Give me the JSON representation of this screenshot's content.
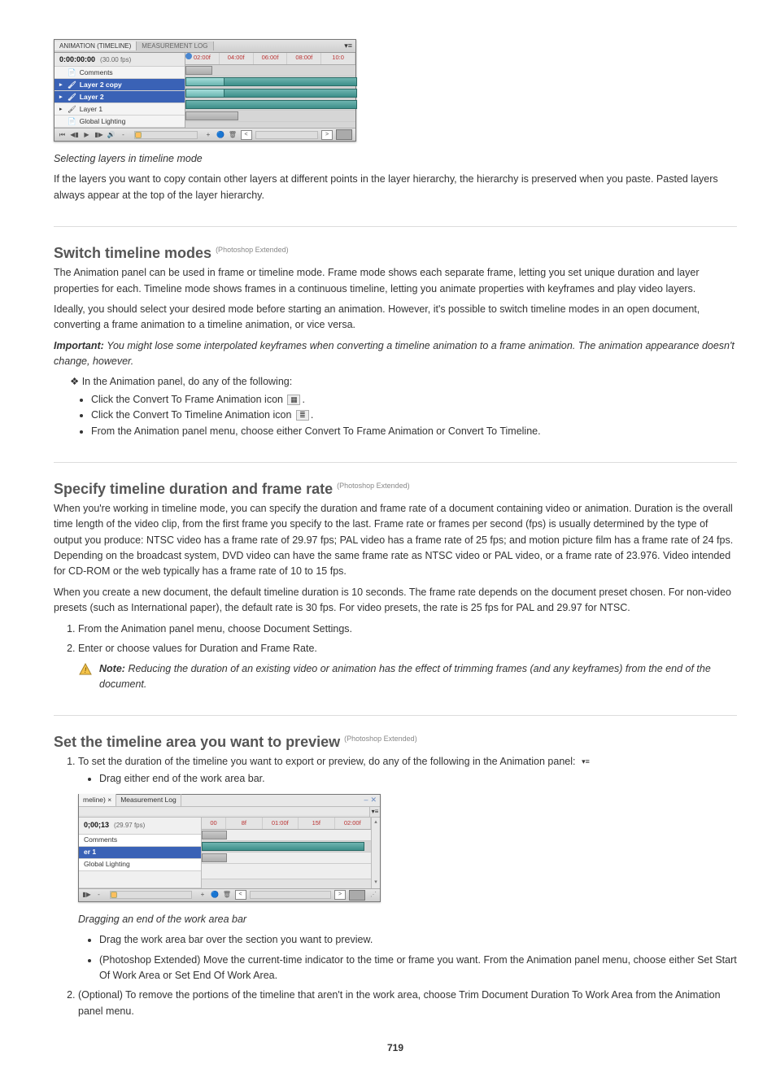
{
  "page_number": "719",
  "panel1": {
    "tab_active": "ANIMATION (TIMELINE)",
    "tab_inactive": "MEASUREMENT LOG",
    "timecode": "0:00:00:00",
    "fps": "(30.00 fps)",
    "rows": [
      "Comments",
      "Layer 2 copy",
      "Layer 2",
      "Layer 1",
      "Global Lighting"
    ],
    "ticks": [
      "02:00f",
      "04:00f",
      "06:00f",
      "08:00f",
      "10:0"
    ]
  },
  "caption1": "Selecting layers in timeline mode",
  "para_after_panel1": "If the layers you want to copy contain other layers at different points in the layer hierarchy, the hierarchy is preserved when you paste. Pasted layers always appear at the top of the layer hierarchy.",
  "heading_switch": "Switch timeline modes",
  "ref_switch": "(Photoshop Extended)",
  "switch_text": "The Animation panel can be used in frame or timeline mode. Frame mode shows each separate frame, letting you set unique duration and layer properties for each. Timeline mode shows frames in a continuous timeline, letting you animate properties with keyframes and play video layers.",
  "switch_text2": "Ideally, you should select your desired mode before starting an animation. However, it's possible to switch timeline modes in an open document, converting a frame animation to a timeline animation, or vice versa.",
  "switch_important_label": "Important:",
  "switch_important": "You might lose some interpolated keyframes when converting a timeline animation to a frame animation. The animation appearance doesn't change, however.",
  "switch_bullet_lead": "In the Animation panel, do any of the following:",
  "switch_bullets": [
    "Click the Convert To Frame Animation icon",
    "Click the Convert To Timeline Animation icon",
    "From the Animation panel menu, choose either Convert To Frame Animation or Convert To Timeline."
  ],
  "switch_inline_period": ".",
  "heading_dur": "Specify timeline duration and frame rate",
  "ref_dur": "(Photoshop Extended)",
  "dur_text": "When you're working in timeline mode, you can specify the duration and frame rate of a document containing video or animation. Duration is the overall time length of the video clip, from the first frame you specify to the last. Frame rate or frames per second (fps) is usually determined by the type of output you produce: NTSC video has a frame rate of 29.97 fps; PAL video has a frame rate of 25 fps; and motion picture film has a frame rate of 24 fps. Depending on the broadcast system, DVD video can have the same frame rate as NTSC video or PAL video, or a frame rate of 23.976. Video intended for CD-ROM or the web typically has a frame rate of 10 to 15 fps.",
  "dur_text2": "When you create a new document, the default timeline duration is 10 seconds. The frame rate depends on the document preset chosen. For non-video presets (such as International paper), the default rate is 30 fps. For video presets, the rate is 25 fps for PAL and 29.97 for NTSC.",
  "dur_steps": [
    "From the Animation panel menu, choose Document Settings.",
    "Enter or choose values for Duration and Frame Rate."
  ],
  "dur_note": "Reducing the duration of an existing video or animation has the effect of trimming frames (and any keyframes) from the end of the document.",
  "heading_set": "Set the timeline area you want to preview",
  "ref_set": "(Photoshop Extended)",
  "set_steps": {
    "step1": "To set the duration of the timeline you want to export or preview, do any of the following in the Animation panel:",
    "step1_bullets": [
      "Drag either end of the work area bar."
    ],
    "step1_img_caption": "Dragging an end of the work area bar",
    "step1_bullets_more": [
      "Drag the work area bar over the section you want to preview.",
      "(Photoshop Extended) Move the current-time indicator to the time or frame you want. From the Animation panel menu, choose either Set Start Of Work Area or Set End Of Work Area."
    ],
    "step2": "(Optional) To remove the portions of the timeline that aren't in the work area, choose Trim Document Duration To Work Area from the Animation panel menu."
  },
  "panel2": {
    "tab_left": "meline)",
    "tab_x": "×",
    "tab_right": "Measurement Log",
    "timecode": "0;00;13",
    "fps": "(29.97 fps)",
    "rows": [
      "Comments",
      "er 1",
      "Global Lighting"
    ],
    "ticks": [
      "00",
      "8f",
      "01:00f",
      "15f",
      "02:00f"
    ]
  }
}
